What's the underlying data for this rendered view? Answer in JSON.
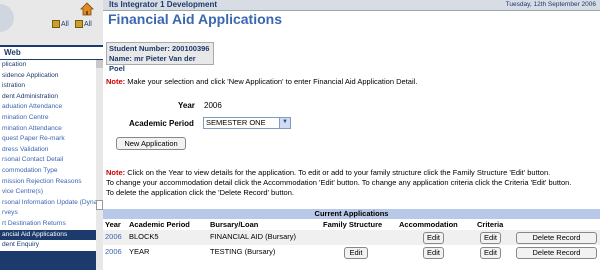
{
  "app": {
    "title": "Its Integrator 1 Development",
    "date": "Tuesday, 12th September 2006"
  },
  "sidebar": {
    "controls": {
      "expand": "All",
      "collapse": "All"
    },
    "header": "Web",
    "items": [
      "plication",
      "sidence Application",
      "istration",
      "dent Administration",
      "aduation Attendance",
      "mination Centre",
      "mination Attendance",
      "quest Paper Re-mark",
      "dress Validation",
      "rsonal Contact Detail",
      "commodation Type",
      "mission Rejection Reasons",
      "vice Centre(s)",
      "rsonal Information Update (Dyna",
      "rveys",
      "rt Destination Returns",
      "ancial Aid Applications",
      "dent Enquiry"
    ],
    "selected_index": 16
  },
  "page": {
    "title": "Financial Aid Applications",
    "student_number_label": "Student Number:",
    "student_number": "200100396",
    "name_label": "Name:",
    "name": "mr Pieter Van der Poel",
    "note_prefix": "Note:",
    "note1": "Make your selection and click 'New Application' to enter Financial Aid Application Detail.",
    "year_label": "Year",
    "year_value": "2006",
    "period_label": "Academic Period",
    "period_value": "SEMESTER ONE",
    "new_app_button": "New Application",
    "note2_line1": "Click on the Year to view details for the application. To edit or add to your family structure click the Family Structure 'Edit' button.",
    "note2_line2": "To change your accommodation detail click the Accommodation 'Edit' button. To change any application criteria click the Criteria 'Edit' button.",
    "note2_line3": "To delete the application click the 'Delete Record' button."
  },
  "table": {
    "title": "Current Applications",
    "headers": {
      "year": "Year",
      "period": "Academic Period",
      "bursary": "Bursary/Loan",
      "family": "Family Structure",
      "accommodation": "Accommodation",
      "criteria": "Criteria"
    },
    "rows": [
      {
        "year": "2006",
        "period": "BLOCK5",
        "bursary": "FINANCIAL AID (Bursary)",
        "family_edit": "",
        "accom_edit": "Edit",
        "criteria_edit": "Edit",
        "delete": "Delete Record"
      },
      {
        "year": "2006",
        "period": "YEAR",
        "bursary": "TESTING (Bursary)",
        "family_edit": "Edit",
        "accom_edit": "Edit",
        "criteria_edit": "Edit",
        "delete": "Delete Record"
      }
    ]
  },
  "colors": {
    "nav_dark": "#1d3a6c",
    "link_blue": "#3a66b2",
    "note_red": "#cc0000",
    "table_header": "#b8c8e8"
  }
}
